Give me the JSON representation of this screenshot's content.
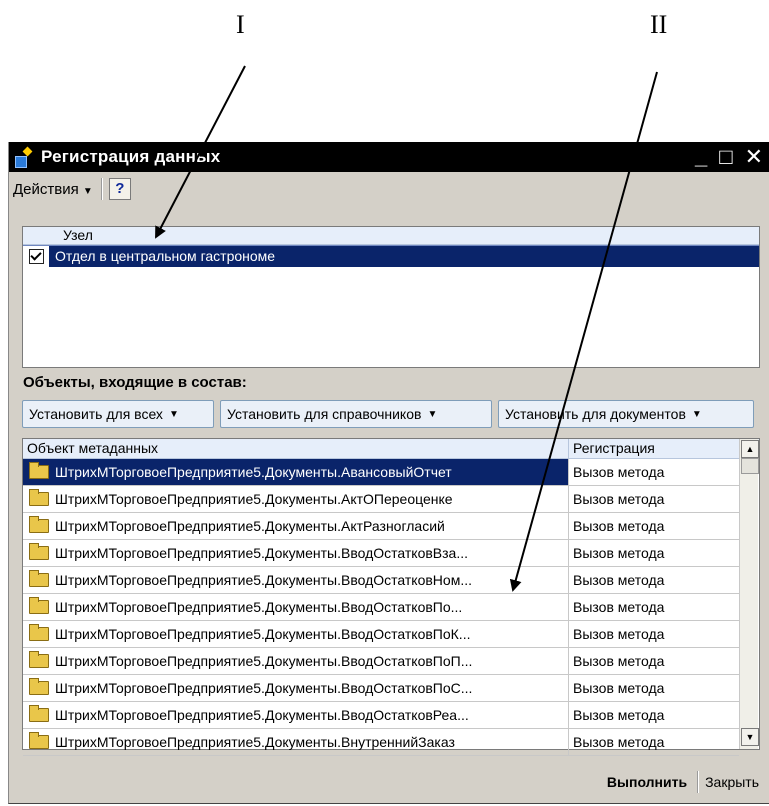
{
  "markers": {
    "left": "I",
    "right": "II"
  },
  "window": {
    "title": "Регистрация данных",
    "controls": {
      "minimize": "_",
      "maximize": "□",
      "close": "✕"
    }
  },
  "menu": {
    "actions": "Действия",
    "help": "?"
  },
  "nodes": {
    "header": "Узел",
    "rows": [
      {
        "checked": true,
        "name": "Отдел в центральном гастрономе"
      }
    ]
  },
  "objects": {
    "label": "Объекты, входящие в состав:",
    "buttons": {
      "all": "Установить для всех",
      "catalogs": "Установить для справочников",
      "documents": "Установить для документов"
    },
    "columns": {
      "object": "Объект метаданных",
      "registration": "Регистрация"
    },
    "rows": [
      {
        "object": "ШтрихМТорговоеПредприятие5.Документы.АвансовыйОтчет",
        "registration": "Вызов метода"
      },
      {
        "object": "ШтрихМТорговоеПредприятие5.Документы.АктОПереоценке",
        "registration": "Вызов метода"
      },
      {
        "object": "ШтрихМТорговоеПредприятие5.Документы.АктРазногласий",
        "registration": "Вызов метода"
      },
      {
        "object": "ШтрихМТорговоеПредприятие5.Документы.ВводОстатковВза...",
        "registration": "Вызов метода"
      },
      {
        "object": "ШтрихМТорговоеПредприятие5.Документы.ВводОстатковНом...",
        "registration": "Вызов метода"
      },
      {
        "object": "ШтрихМТорговоеПредприятие5.Документы.ВводОстатковПо...",
        "registration": "Вызов метода"
      },
      {
        "object": "ШтрихМТорговоеПредприятие5.Документы.ВводОстатковПоК...",
        "registration": "Вызов метода"
      },
      {
        "object": "ШтрихМТорговоеПредприятие5.Документы.ВводОстатковПоП...",
        "registration": "Вызов метода"
      },
      {
        "object": "ШтрихМТорговоеПредприятие5.Документы.ВводОстатковПоС...",
        "registration": "Вызов метода"
      },
      {
        "object": "ШтрихМТорговоеПредприятие5.Документы.ВводОстатковРеа...",
        "registration": "Вызов метода"
      },
      {
        "object": "ШтрихМТорговоеПредприятие5.Документы.ВнутреннийЗаказ",
        "registration": "Вызов метода"
      }
    ]
  },
  "footer": {
    "execute": "Выполнить",
    "close": "Закрыть"
  },
  "colors": {
    "selection": "#0a246a",
    "window_bg": "#d4d0c8",
    "header_bg": "#e6eefa"
  }
}
